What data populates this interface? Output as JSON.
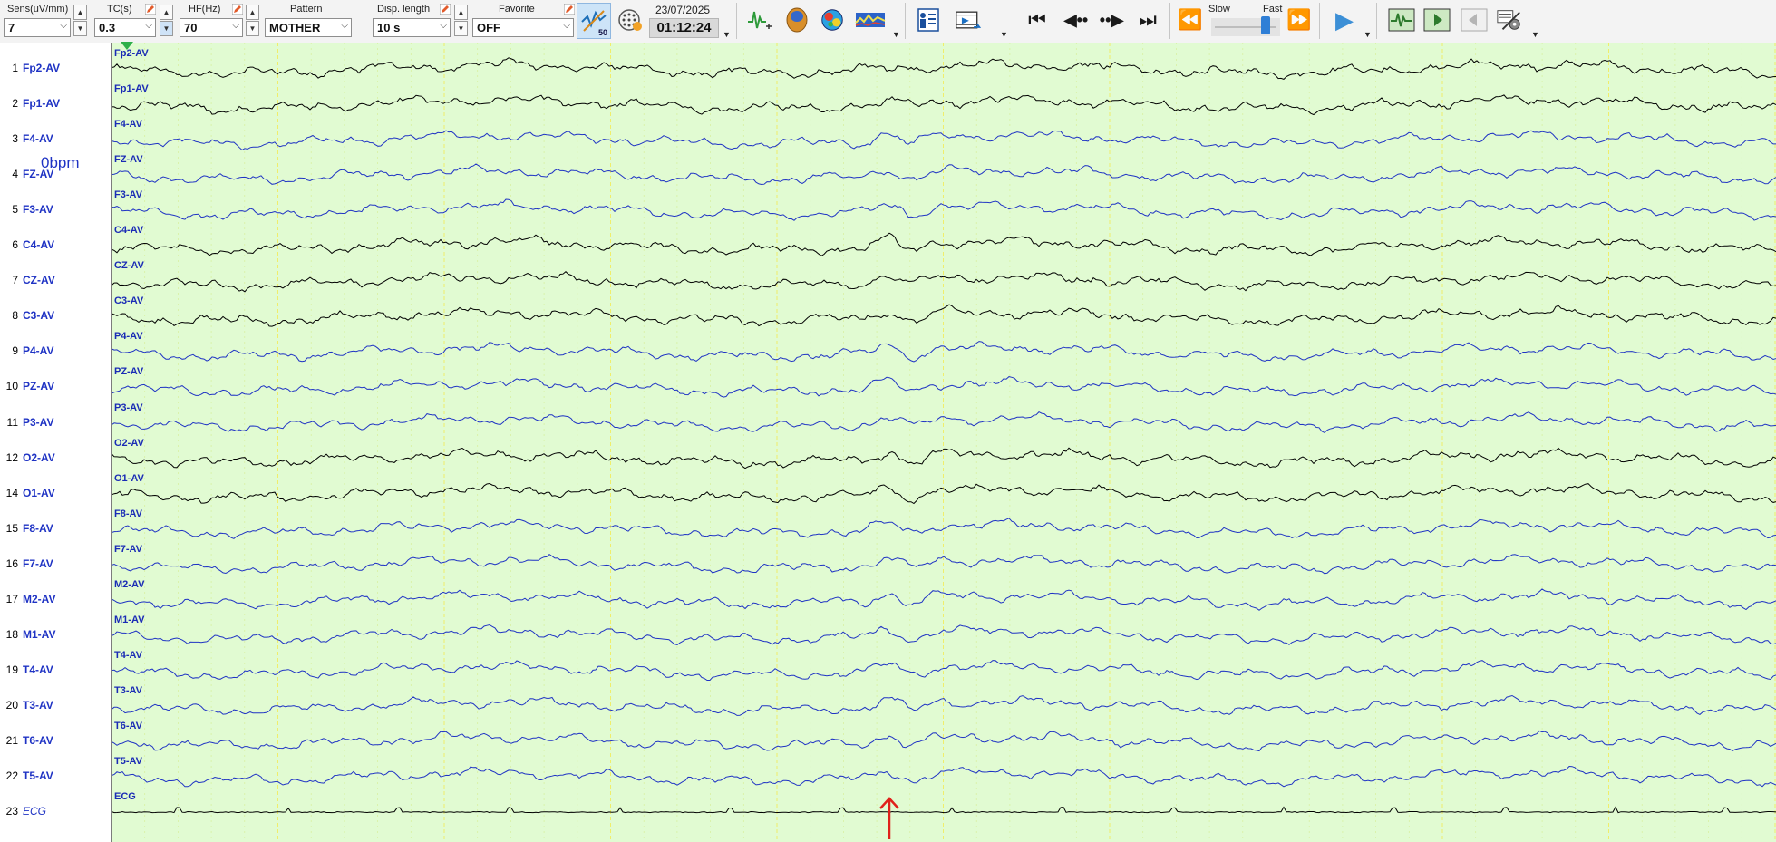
{
  "toolbar": {
    "sensitivity": {
      "label": "Sens(uV/mm)",
      "value": "7"
    },
    "time_constant": {
      "label": "TC(s)",
      "value": "0.3"
    },
    "high_filter": {
      "label": "HF(Hz)",
      "value": "70"
    },
    "pattern": {
      "label": "Pattern",
      "value": "MOTHER"
    },
    "display_length": {
      "label": "Disp. length",
      "value": "10 s"
    },
    "favorite": {
      "label": "Favorite",
      "value": "OFF"
    },
    "badge_50": "50",
    "date": "23/07/2025",
    "time": "01:12:24",
    "speed": {
      "slow_label": "Slow",
      "fast_label": "Fast",
      "level": 0.85
    }
  },
  "heart_rate": "0bpm",
  "channels": [
    {
      "num": "1",
      "name": "Fp2-AV",
      "trace_label": "Fp2-AV",
      "color": "#000000"
    },
    {
      "num": "2",
      "name": "Fp1-AV",
      "trace_label": "Fp1-AV",
      "color": "#000000"
    },
    {
      "num": "3",
      "name": "F4-AV",
      "trace_label": "F4-AV",
      "color": "#1f33c4"
    },
    {
      "num": "4",
      "name": "FZ-AV",
      "trace_label": "FZ-AV",
      "color": "#1f33c4"
    },
    {
      "num": "5",
      "name": "F3-AV",
      "trace_label": "F3-AV",
      "color": "#1f33c4"
    },
    {
      "num": "6",
      "name": "C4-AV",
      "trace_label": "C4-AV",
      "color": "#000000"
    },
    {
      "num": "7",
      "name": "CZ-AV",
      "trace_label": "CZ-AV",
      "color": "#000000"
    },
    {
      "num": "8",
      "name": "C3-AV",
      "trace_label": "C3-AV",
      "color": "#000000"
    },
    {
      "num": "9",
      "name": "P4-AV",
      "trace_label": "P4-AV",
      "color": "#1f33c4"
    },
    {
      "num": "10",
      "name": "PZ-AV",
      "trace_label": "PZ-AV",
      "color": "#1f33c4"
    },
    {
      "num": "11",
      "name": "P3-AV",
      "trace_label": "P3-AV",
      "color": "#1f33c4"
    },
    {
      "num": "12",
      "name": "O2-AV",
      "trace_label": "O2-AV",
      "color": "#000000"
    },
    {
      "num": "14",
      "name": "O1-AV",
      "trace_label": "O1-AV",
      "color": "#000000"
    },
    {
      "num": "15",
      "name": "F8-AV",
      "trace_label": "F8-AV",
      "color": "#1f33c4"
    },
    {
      "num": "16",
      "name": "F7-AV",
      "trace_label": "F7-AV",
      "color": "#1f33c4"
    },
    {
      "num": "17",
      "name": "M2-AV",
      "trace_label": "M2-AV",
      "color": "#1f33c4"
    },
    {
      "num": "18",
      "name": "M1-AV",
      "trace_label": "M1-AV",
      "color": "#1f33c4"
    },
    {
      "num": "19",
      "name": "T4-AV",
      "trace_label": "T4-AV",
      "color": "#1f33c4"
    },
    {
      "num": "20",
      "name": "T3-AV",
      "trace_label": "T3-AV",
      "color": "#1f33c4"
    },
    {
      "num": "21",
      "name": "T6-AV",
      "trace_label": "T6-AV",
      "color": "#1f33c4"
    },
    {
      "num": "22",
      "name": "T5-AV",
      "trace_label": "T5-AV",
      "color": "#1f33c4"
    },
    {
      "num": "23",
      "name": "ECG",
      "trace_label": "ECG",
      "color": "#000000"
    }
  ],
  "colors": {
    "trace_background": "#e1fbd2",
    "second_gridline": "#f0ee6a",
    "channel_label": "#1f33c4",
    "time_marker": "#2fb04a",
    "event_arrow": "#e0211b",
    "speed_thumb": "#2f7fd6"
  },
  "icons": [
    "waveform-icon",
    "head-model-icon",
    "brain-map-icon",
    "spectrum-icon",
    "patient-info-icon",
    "video-icon",
    "skip-start-icon",
    "step-back-icon",
    "step-forward-icon",
    "skip-end-icon",
    "rewind-icon",
    "fast-forward-icon",
    "play-icon",
    "montage-icon",
    "next-page-icon",
    "prev-page-icon",
    "settings-icon"
  ]
}
